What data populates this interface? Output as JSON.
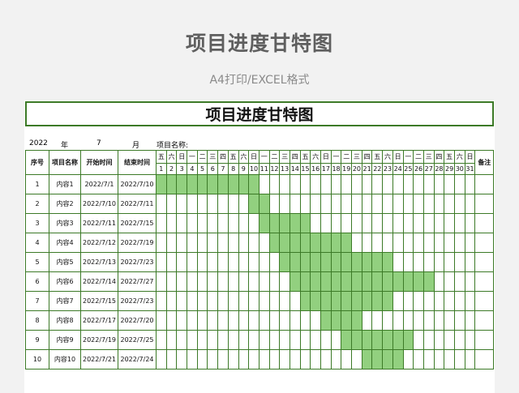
{
  "page": {
    "title": "项目进度甘特图",
    "subtitle": "A4打印/EXCEL格式"
  },
  "sheet": {
    "banner_title": "项目进度甘特图",
    "year": "2022",
    "year_label": "年",
    "month": "7",
    "month_label": "月",
    "project_label": "项目名称:"
  },
  "table": {
    "headers": {
      "index": "序号",
      "name": "项目名称",
      "start": "开始时间",
      "end": "结束时间",
      "note": "备注"
    },
    "weekdays": [
      "五",
      "六",
      "日",
      "一",
      "二",
      "三",
      "四",
      "五",
      "六",
      "日",
      "一",
      "二",
      "三",
      "四",
      "五",
      "六",
      "日",
      "一",
      "二",
      "三",
      "四",
      "五",
      "六",
      "日",
      "一",
      "二",
      "三",
      "四",
      "五",
      "六",
      "日"
    ],
    "days": [
      "1",
      "2",
      "3",
      "4",
      "5",
      "6",
      "7",
      "8",
      "9",
      "10",
      "11",
      "12",
      "13",
      "14",
      "15",
      "16",
      "17",
      "18",
      "19",
      "20",
      "21",
      "22",
      "23",
      "24",
      "25",
      "26",
      "27",
      "28",
      "29",
      "30",
      "31"
    ],
    "rows": [
      {
        "index": "1",
        "name": "内容1",
        "start": "2022/7/1",
        "end": "2022/7/10",
        "from": 1,
        "to": 10
      },
      {
        "index": "2",
        "name": "内容2",
        "start": "2022/7/10",
        "end": "2022/7/11",
        "from": 10,
        "to": 11
      },
      {
        "index": "3",
        "name": "内容3",
        "start": "2022/7/11",
        "end": "2022/7/15",
        "from": 11,
        "to": 15
      },
      {
        "index": "4",
        "name": "内容4",
        "start": "2022/7/12",
        "end": "2022/7/19",
        "from": 12,
        "to": 19
      },
      {
        "index": "5",
        "name": "内容5",
        "start": "2022/7/13",
        "end": "2022/7/23",
        "from": 13,
        "to": 23
      },
      {
        "index": "6",
        "name": "内容6",
        "start": "2022/7/14",
        "end": "2022/7/27",
        "from": 14,
        "to": 27
      },
      {
        "index": "7",
        "name": "内容7",
        "start": "2022/7/15",
        "end": "2022/7/23",
        "from": 15,
        "to": 23
      },
      {
        "index": "8",
        "name": "内容8",
        "start": "2022/7/17",
        "end": "2022/7/20",
        "from": 17,
        "to": 20
      },
      {
        "index": "9",
        "name": "内容9",
        "start": "2022/7/19",
        "end": "2022/7/25",
        "from": 19,
        "to": 25
      },
      {
        "index": "10",
        "name": "内容10",
        "start": "2022/7/21",
        "end": "2022/7/24",
        "from": 21,
        "to": 24
      }
    ]
  },
  "colors": {
    "border": "#3c7a27",
    "bar": "#92d07f"
  }
}
